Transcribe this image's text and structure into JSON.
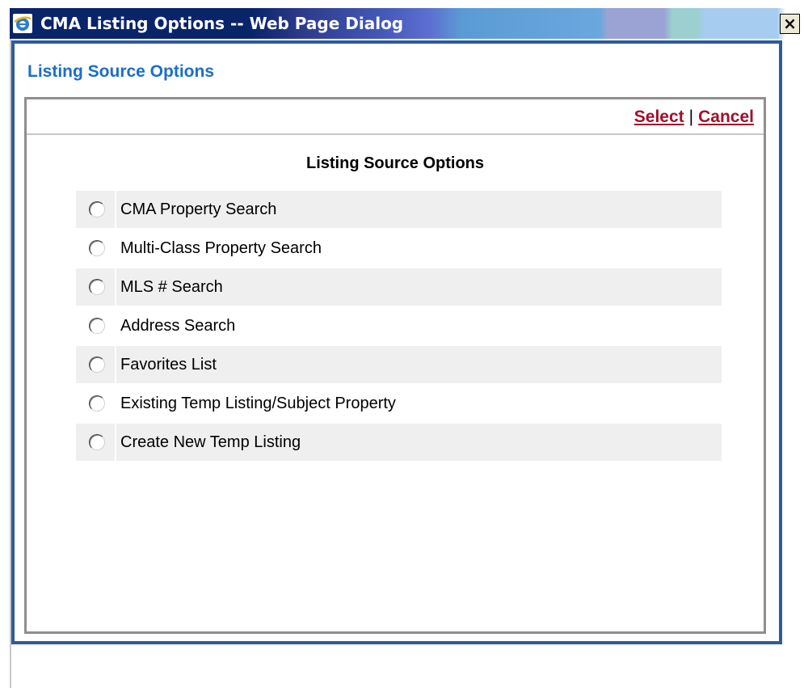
{
  "window": {
    "title": "CMA Listing Options -- Web Page Dialog",
    "close_label": "×",
    "app_icon": "ie-icon"
  },
  "page": {
    "heading": "Listing Source Options"
  },
  "toolbar": {
    "select_label": "Select",
    "separator": "|",
    "cancel_label": "Cancel"
  },
  "section": {
    "title": "Listing Source Options"
  },
  "options": [
    {
      "label": "CMA Property Search",
      "selected": false
    },
    {
      "label": "Multi-Class Property Search",
      "selected": false
    },
    {
      "label": "MLS # Search",
      "selected": false
    },
    {
      "label": "Address Search",
      "selected": false
    },
    {
      "label": "Favorites List",
      "selected": false
    },
    {
      "label": "Existing Temp Listing/Subject Property",
      "selected": false
    },
    {
      "label": "Create New Temp Listing",
      "selected": false
    }
  ],
  "colors": {
    "titlebar": "#0a246a",
    "heading": "#1a6ec8",
    "frame_border": "#2f5b9b",
    "link": "#a0102a",
    "row_shade": "#efefef"
  }
}
